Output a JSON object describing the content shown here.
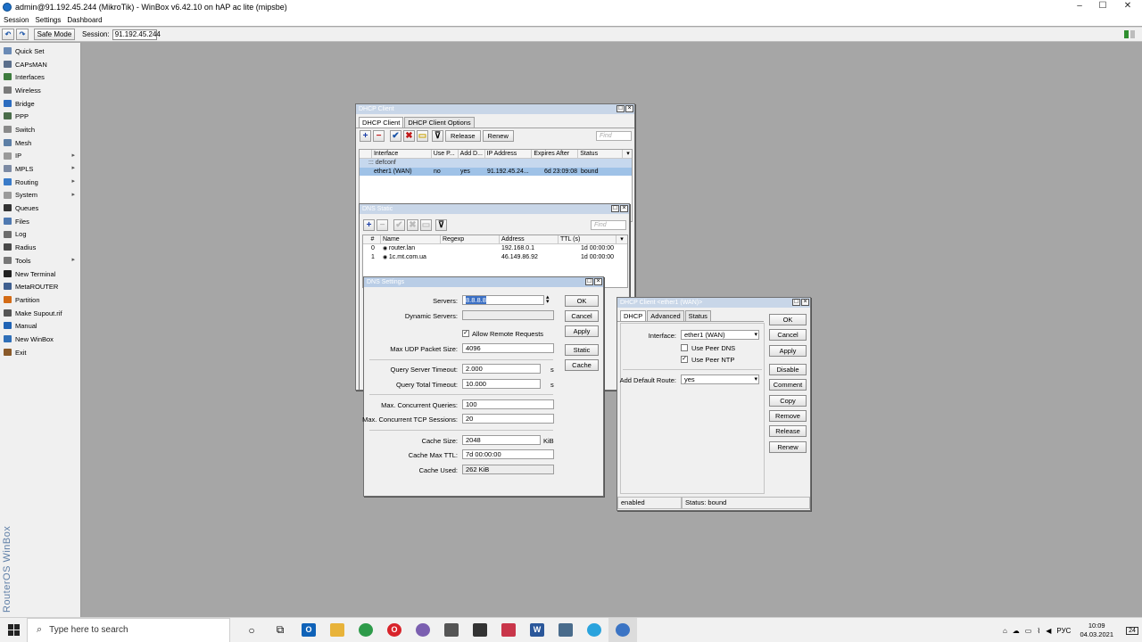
{
  "window": {
    "title": "admin@91.192.45.244 (MikroTik) - WinBox v6.42.10 on hAP ac lite (mipsbe)",
    "controls": [
      "–",
      "☐",
      "✕"
    ]
  },
  "menu": [
    "Session",
    "Settings",
    "Dashboard"
  ],
  "toolbar": {
    "undo": "↶",
    "redo": "↷",
    "safe_mode": "Safe Mode",
    "session_label": "Session:",
    "session_value": "91.192.45.244"
  },
  "sidebar": {
    "items": [
      {
        "label": "Quick Set",
        "icon": "quick-set",
        "color": "#6a8ab5",
        "submenu": false
      },
      {
        "label": "CAPsMAN",
        "icon": "capsman",
        "color": "#5b6f8c",
        "submenu": false
      },
      {
        "label": "Interfaces",
        "icon": "interfaces",
        "color": "#3e7c3e",
        "submenu": false
      },
      {
        "label": "Wireless",
        "icon": "wireless",
        "color": "#7a7a7a",
        "submenu": false
      },
      {
        "label": "Bridge",
        "icon": "bridge",
        "color": "#2c6cbf",
        "submenu": false
      },
      {
        "label": "PPP",
        "icon": "ppp",
        "color": "#4a6d4a",
        "submenu": false
      },
      {
        "label": "Switch",
        "icon": "switch",
        "color": "#8a8a8a",
        "submenu": false
      },
      {
        "label": "Mesh",
        "icon": "mesh",
        "color": "#5d7fa6",
        "submenu": false
      },
      {
        "label": "IP",
        "icon": "ip",
        "color": "#9a9a9a",
        "submenu": true
      },
      {
        "label": "MPLS",
        "icon": "mpls",
        "color": "#7c8aa3",
        "submenu": true
      },
      {
        "label": "Routing",
        "icon": "routing",
        "color": "#3a7bc8",
        "submenu": true
      },
      {
        "label": "System",
        "icon": "system",
        "color": "#9a9a9a",
        "submenu": true
      },
      {
        "label": "Queues",
        "icon": "queues",
        "color": "#333333",
        "submenu": false
      },
      {
        "label": "Files",
        "icon": "files",
        "color": "#4f79b0",
        "submenu": false
      },
      {
        "label": "Log",
        "icon": "log",
        "color": "#6d6d6d",
        "submenu": false
      },
      {
        "label": "Radius",
        "icon": "radius",
        "color": "#4a4a4a",
        "submenu": false
      },
      {
        "label": "Tools",
        "icon": "tools",
        "color": "#777777",
        "submenu": true
      },
      {
        "label": "New Terminal",
        "icon": "terminal",
        "color": "#222222",
        "submenu": false
      },
      {
        "label": "MetaROUTER",
        "icon": "metarouter",
        "color": "#3f5f8f",
        "submenu": false
      },
      {
        "label": "Partition",
        "icon": "partition",
        "color": "#d36b16",
        "submenu": false
      },
      {
        "label": "Make Supout.rif",
        "icon": "supout",
        "color": "#555555",
        "submenu": false
      },
      {
        "label": "Manual",
        "icon": "manual",
        "color": "#1f63b5",
        "submenu": false
      },
      {
        "label": "New WinBox",
        "icon": "winbox",
        "color": "#2f6fb8",
        "submenu": false
      },
      {
        "label": "Exit",
        "icon": "exit",
        "color": "#8a5a2a",
        "submenu": false
      }
    ],
    "brand": "RouterOS WinBox"
  },
  "dhcp_client": {
    "title": "DHCP Client",
    "tabs": [
      "DHCP Client",
      "DHCP Client Options"
    ],
    "release": "Release",
    "renew": "Renew",
    "find": "Find",
    "columns": [
      "Interface",
      "Use P...",
      "Add D...",
      "IP Address",
      "Expires After",
      "Status"
    ],
    "comment": "::: defconf",
    "rows": [
      {
        "interface": "ether1 (WAN)",
        "use_peer": "no",
        "add_default": "yes",
        "ip": "91.192.45.24...",
        "expires": "6d 23:09:08",
        "status": "bound"
      }
    ]
  },
  "dns_static": {
    "title": "DNS Static",
    "find": "Find",
    "columns": [
      "#",
      "Name",
      "Regexp",
      "Address",
      "TTL (s)"
    ],
    "rows": [
      {
        "num": "0",
        "name": "router.lan",
        "regexp": "",
        "address": "192.168.0.1",
        "ttl": "1d 00:00:00"
      },
      {
        "num": "1",
        "name": "1c.mt.com.ua",
        "regexp": "",
        "address": "46.149.86.92",
        "ttl": "1d 00:00:00"
      }
    ]
  },
  "dns_settings": {
    "title": "DNS Settings",
    "servers_label": "Servers:",
    "servers_value": "8.8.8.8",
    "dynamic_label": "Dynamic Servers:",
    "allow_remote": "Allow Remote Requests",
    "udp_label": "Max UDP Packet Size:",
    "udp_value": "4096",
    "qst_label": "Query Server Timeout:",
    "qst_value": "2.000",
    "qst_unit": "s",
    "qtt_label": "Query Total Timeout:",
    "qtt_value": "10.000",
    "qtt_unit": "s",
    "mcq_label": "Max. Concurrent Queries:",
    "mcq_value": "100",
    "mct_label": "Max. Concurrent TCP Sessions:",
    "mct_value": "20",
    "cs_label": "Cache Size:",
    "cs_value": "2048",
    "cs_unit": "KiB",
    "cmt_label": "Cache Max TTL:",
    "cmt_value": "7d 00:00:00",
    "cu_label": "Cache Used:",
    "cu_value": "262 KiB",
    "buttons": {
      "ok": "OK",
      "cancel": "Cancel",
      "apply": "Apply",
      "static": "Static",
      "cache": "Cache"
    }
  },
  "dhcp_client_detail": {
    "title": "DHCP Client <ether1 (WAN)>",
    "tabs": [
      "DHCP",
      "Advanced",
      "Status"
    ],
    "interface_label": "Interface:",
    "interface_value": "ether1 (WAN)",
    "use_peer_dns": "Use Peer DNS",
    "use_peer_ntp": "Use Peer NTP",
    "default_route_label": "Add Default Route:",
    "default_route_value": "yes",
    "buttons": [
      "OK",
      "Cancel",
      "Apply",
      "Disable",
      "Comment",
      "Copy",
      "Remove",
      "Release",
      "Renew"
    ],
    "status_left": "enabled",
    "status_right": "Status: bound"
  },
  "taskbar": {
    "search_placeholder": "Type here to search",
    "lang": "РУС",
    "time": "10:09",
    "date": "04.03.2021",
    "notif_count": "24"
  }
}
